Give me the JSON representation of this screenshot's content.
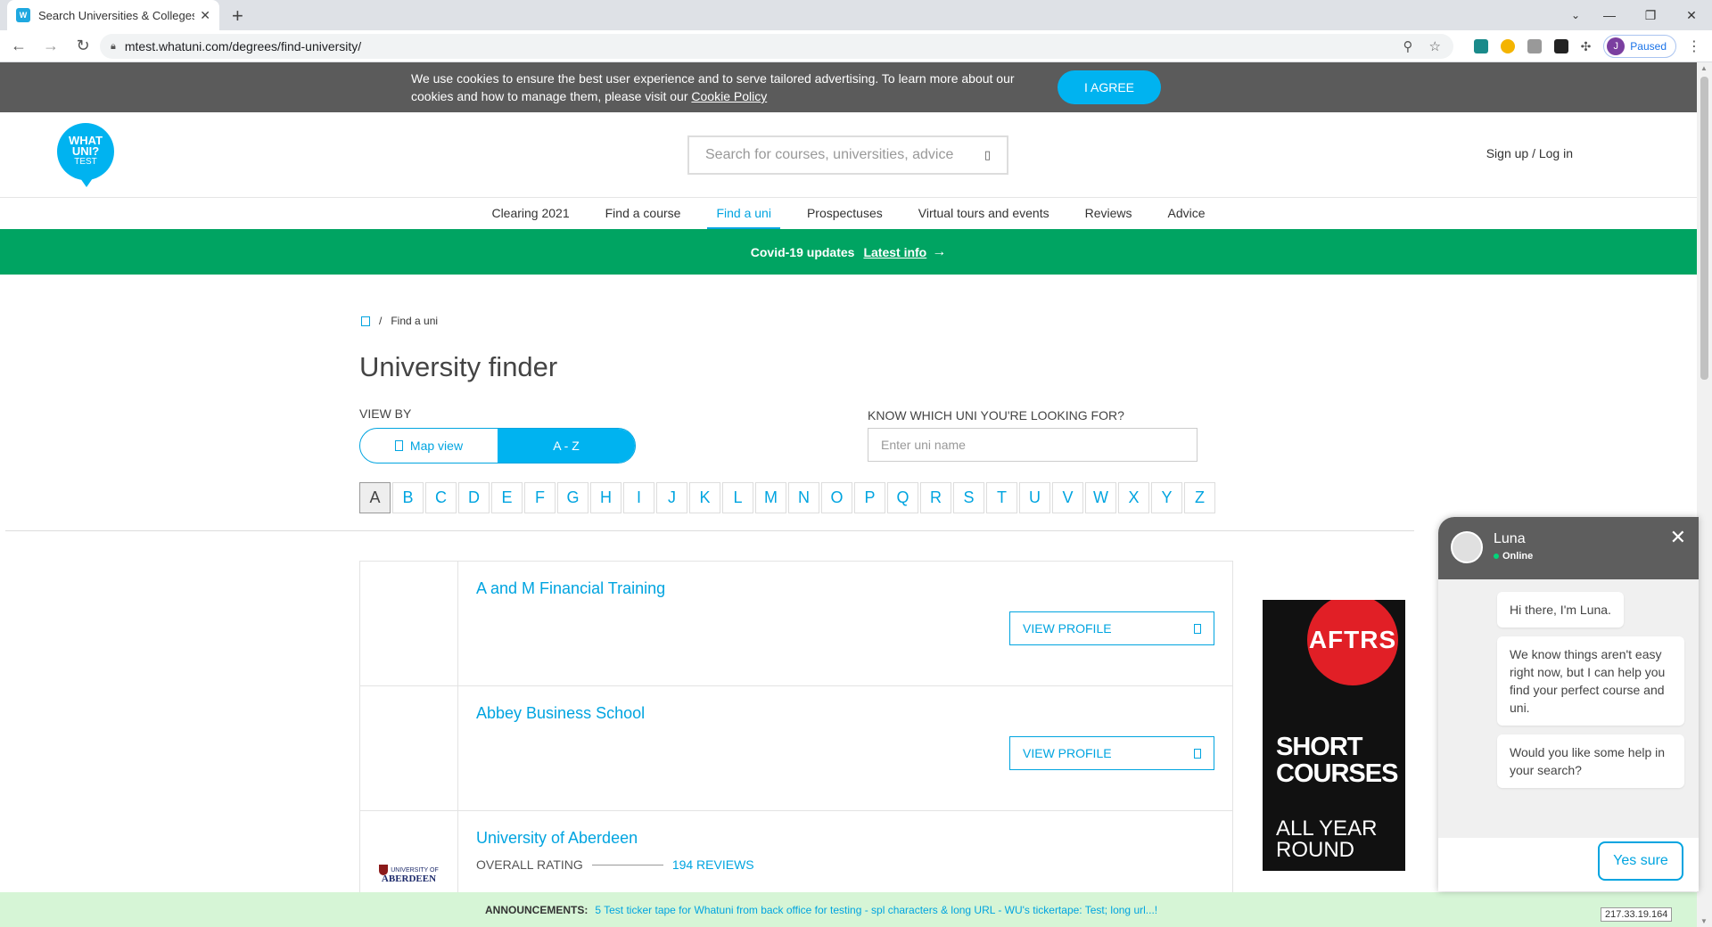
{
  "browser": {
    "tab_title": "Search Universities & Colleges | U",
    "url": "mtest.whatuni.com/degrees/find-university/",
    "profile_initial": "J",
    "profile_status": "Paused"
  },
  "cookie_banner": {
    "text": "We use cookies to ensure the best user experience and to serve tailored advertising. To learn more about our cookies and how to manage them, please visit our",
    "link": "Cookie Policy",
    "button": "I AGREE"
  },
  "header": {
    "logo_line1": "WHAT",
    "logo_line2": "UNI?",
    "logo_line3": "TEST",
    "search_placeholder": "Search for courses, universities, advice",
    "signup": "Sign up / Log in"
  },
  "nav": [
    {
      "label": "Clearing 2021"
    },
    {
      "label": "Find a course"
    },
    {
      "label": "Find a uni"
    },
    {
      "label": "Prospectuses"
    },
    {
      "label": "Virtual tours and events"
    },
    {
      "label": "Reviews"
    },
    {
      "label": "Advice"
    }
  ],
  "covid": {
    "label": "Covid-19 updates",
    "link": "Latest info"
  },
  "breadcrumb": {
    "current": "Find a uni"
  },
  "finder": {
    "title": "University finder",
    "view_by": "VIEW BY",
    "map_view": "Map view",
    "az_view": "A - Z",
    "know_label": "KNOW WHICH UNI YOU'RE LOOKING FOR?",
    "uni_placeholder": "Enter uni name",
    "letters": [
      "A",
      "B",
      "C",
      "D",
      "E",
      "F",
      "G",
      "H",
      "I",
      "J",
      "K",
      "L",
      "M",
      "N",
      "O",
      "P",
      "Q",
      "R",
      "S",
      "T",
      "U",
      "V",
      "W",
      "X",
      "Y",
      "Z"
    ],
    "selected_letter": "A"
  },
  "results": [
    {
      "name": "A and M Financial Training",
      "button": "VIEW PROFILE"
    },
    {
      "name": "Abbey Business School",
      "button": "VIEW PROFILE"
    },
    {
      "name": "University of Aberdeen",
      "rating_label": "OVERALL RATING",
      "reviews": "194 REVIEWS",
      "logo_small": "UNIVERSITY OF",
      "logo_big": "ABERDEEN"
    }
  ],
  "ad": {
    "brand": "AFTRS",
    "line1": "SHORT",
    "line2": "COURSES",
    "line3": "ALL YEAR",
    "line4": "ROUND"
  },
  "chat": {
    "name": "Luna",
    "status": "Online",
    "messages": [
      "Hi there, I'm Luna.",
      "We know things aren't easy right now, but I can help you find your perfect course and uni.",
      "Would you like some help in your search?"
    ],
    "reply": "Yes sure"
  },
  "ticker": {
    "label": "ANNOUNCEMENTS:",
    "message": "5 Test ticker tape for Whatuni from back office for testing - spl characters & long URL - WU's tickertape: Test; long url...!"
  },
  "ip": "217.33.19.164"
}
